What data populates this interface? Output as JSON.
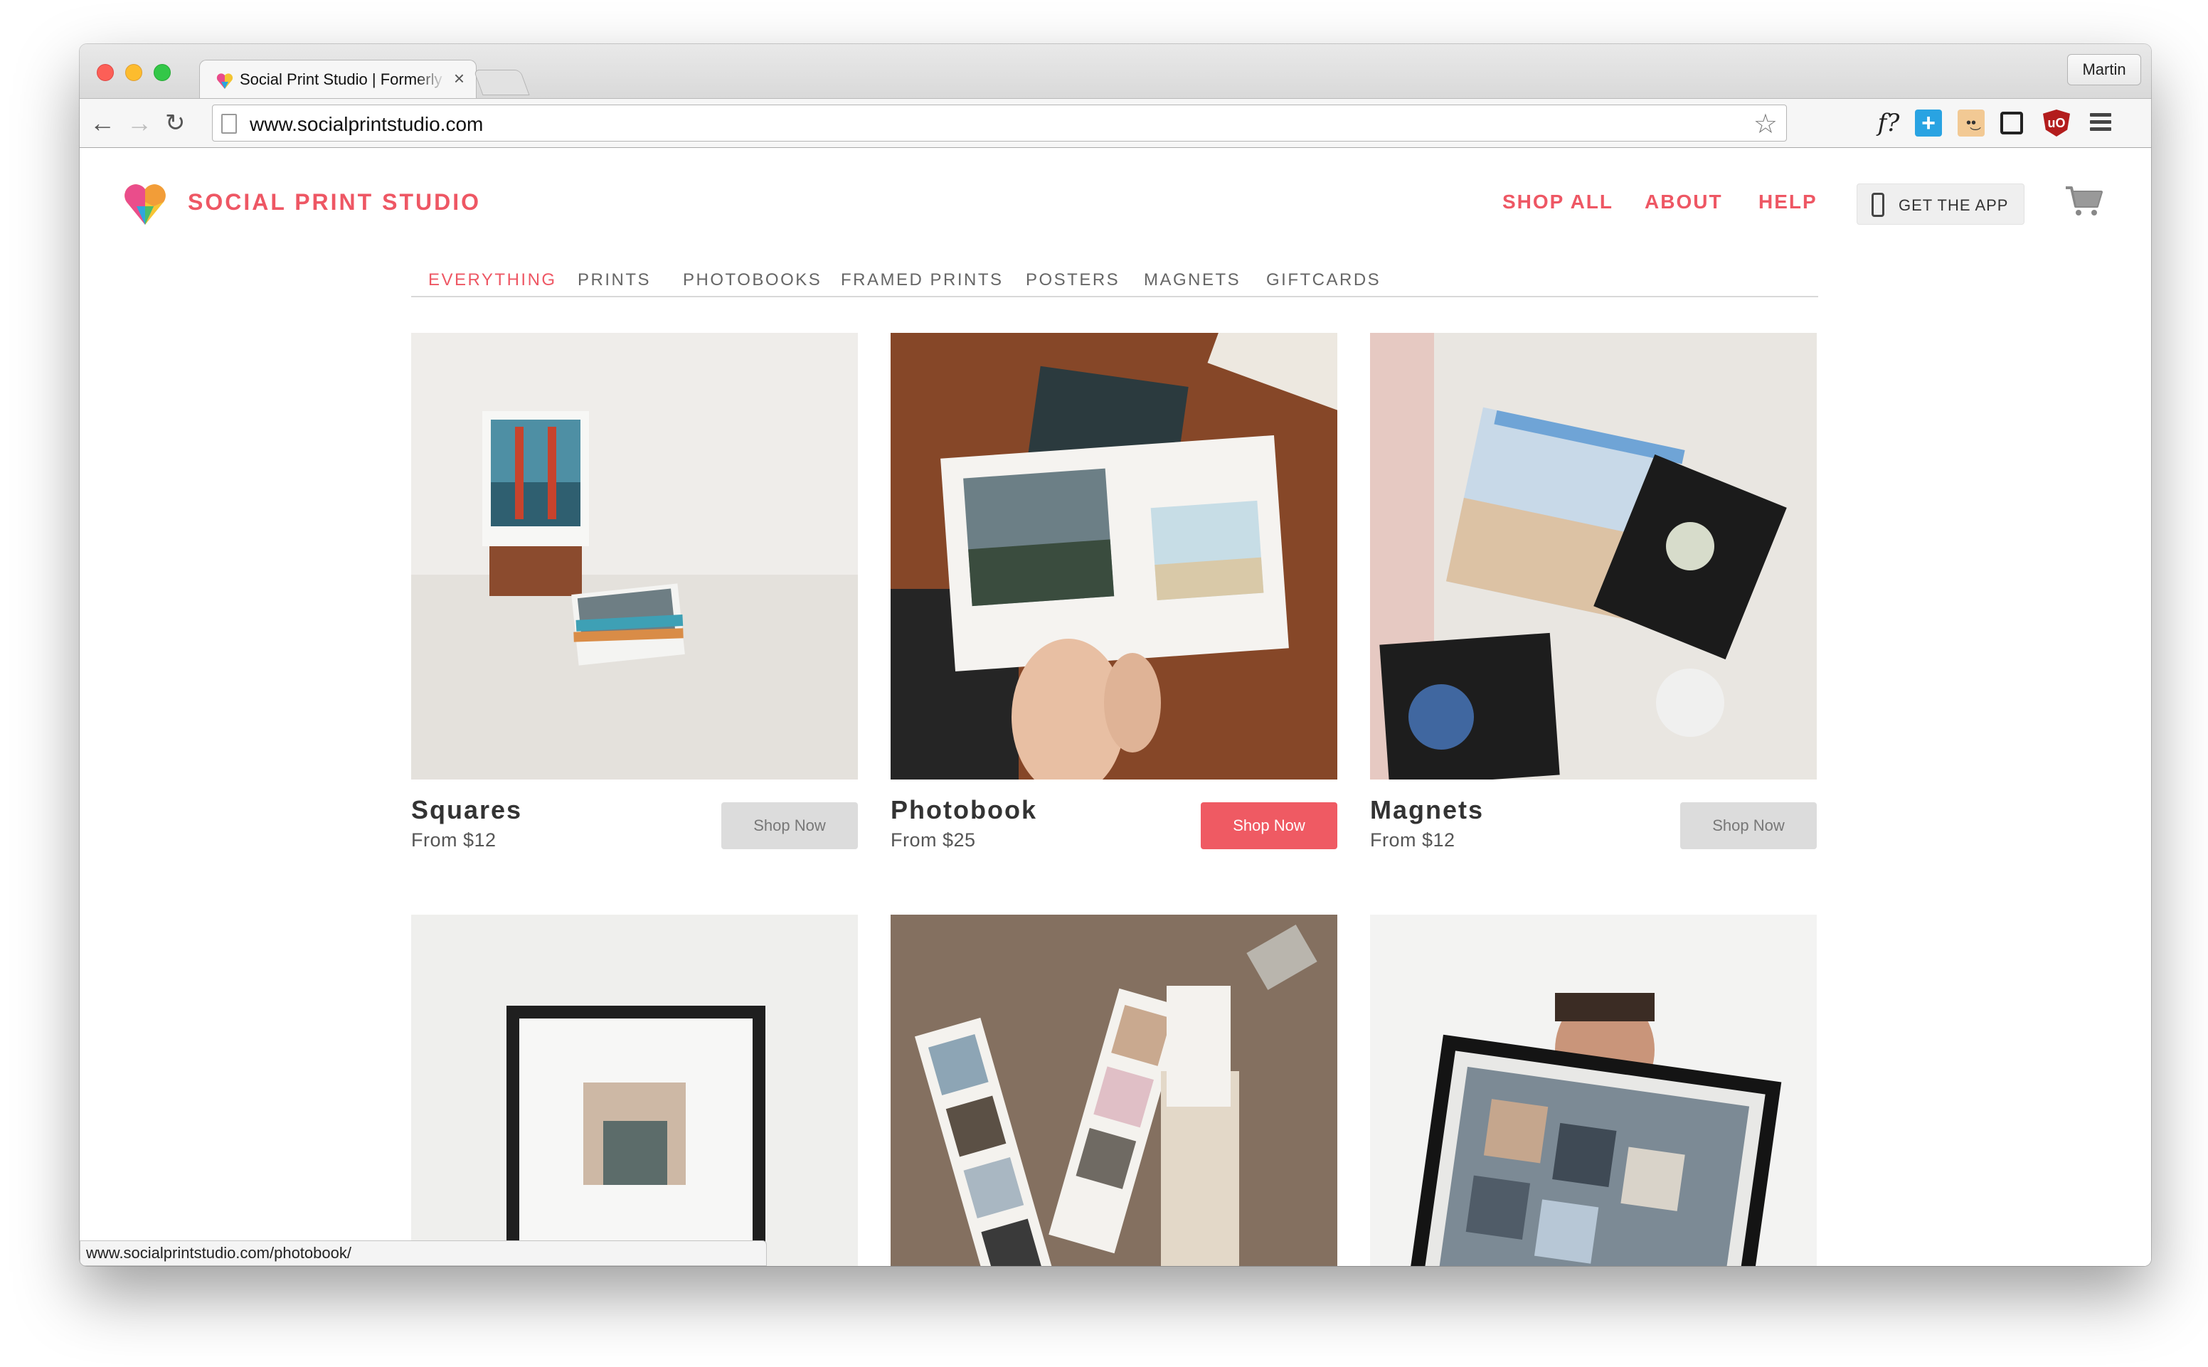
{
  "browser": {
    "tab_title": "Social Print Studio | Formerly Printstagram",
    "tab_close": "×",
    "profile_name": "Martin",
    "url": "www.socialprintstudio.com",
    "back_glyph": "←",
    "forward_glyph": "→",
    "reload_glyph": "↻",
    "star_glyph": "☆",
    "extensions": {
      "f_label": "f?",
      "plus_label": "+",
      "face_label": "•͜•",
      "ublock_label": "uO"
    },
    "status_url": "www.socialprintstudio.com/photobook/"
  },
  "header": {
    "brand": "SOCIAL PRINT STUDIO",
    "nav": {
      "shop_all": "SHOP ALL",
      "about": "ABOUT",
      "help": "HELP"
    },
    "get_app": "GET THE APP"
  },
  "subnav": {
    "items": [
      "EVERYTHING",
      "PRINTS",
      "PHOTOBOOKS",
      "FRAMED PRINTS",
      "POSTERS",
      "MAGNETS",
      "GIFTCARDS"
    ],
    "active": "EVERYTHING"
  },
  "products": [
    {
      "title": "Squares",
      "price": "From $12",
      "button": "Shop Now"
    },
    {
      "title": "Photobook",
      "price": "From $25",
      "button": "Shop Now"
    },
    {
      "title": "Magnets",
      "price": "From $12",
      "button": "Shop Now"
    }
  ],
  "colors": {
    "brand_red": "#ee5764",
    "button_primary": "#ef5a63",
    "button_secondary": "#dcdcdc"
  },
  "icons": {
    "logo": "heart-pin-logo",
    "phone": "phone-icon",
    "cart": "cart-icon"
  }
}
